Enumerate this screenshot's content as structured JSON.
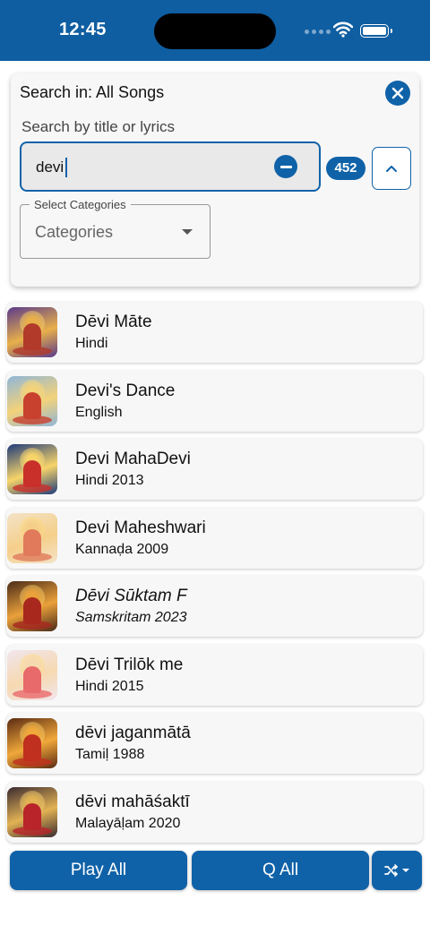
{
  "status_bar": {
    "time": "12:45",
    "bg_color": "#0f5ea1",
    "icons": [
      "signal-icon",
      "wifi-icon",
      "battery-icon"
    ]
  },
  "search": {
    "title": "Search in: All Songs",
    "hint": "Search by title or lyrics",
    "query": "devi",
    "result_count": "452",
    "categories_label": "Select Categories",
    "categories_value": "Categories",
    "accent_color": "#1062a8"
  },
  "songs": [
    {
      "title": "Dēvi Māte",
      "subtitle": "Hindi",
      "italic": false,
      "thumb": [
        "#e8b04a",
        "#b23a2a",
        "#5a3a8a"
      ]
    },
    {
      "title": "Devi's Dance",
      "subtitle": "English",
      "italic": false,
      "thumb": [
        "#f3d27a",
        "#c8402e",
        "#8fb6d8"
      ]
    },
    {
      "title": "Devi MahaDevi",
      "subtitle": "Hindi 2013",
      "italic": false,
      "thumb": [
        "#f7d46a",
        "#c9302a",
        "#1e3a7a"
      ]
    },
    {
      "title": "Devi Maheshwari",
      "subtitle": "Kannaḍa 2009",
      "italic": false,
      "thumb": [
        "#f5cf8a",
        "#e07a5a",
        "#f3e3c8"
      ]
    },
    {
      "title": "Dēvi Sūktam F",
      "subtitle": "Samskritam 2023",
      "italic": true,
      "thumb": [
        "#e9a13a",
        "#a8281e",
        "#4a2a18"
      ]
    },
    {
      "title": "Dēvi Trilōk me",
      "subtitle": "Hindi 2015",
      "italic": false,
      "thumb": [
        "#f6d9b0",
        "#e86a6a",
        "#f1e6ee"
      ]
    },
    {
      "title": "dēvi jaganmātā",
      "subtitle": "Tamiḷ 1988",
      "italic": false,
      "thumb": [
        "#f0a83a",
        "#c0301e",
        "#5a2a12"
      ]
    },
    {
      "title": "dēvi mahāśaktī",
      "subtitle": "Malayāḷam 2020",
      "italic": false,
      "thumb": [
        "#e2b254",
        "#b8242a",
        "#3a2a30"
      ]
    }
  ],
  "actions": {
    "play_all": "Play All",
    "queue_all": "Q All",
    "shuffle_icon": "shuffle-icon"
  }
}
